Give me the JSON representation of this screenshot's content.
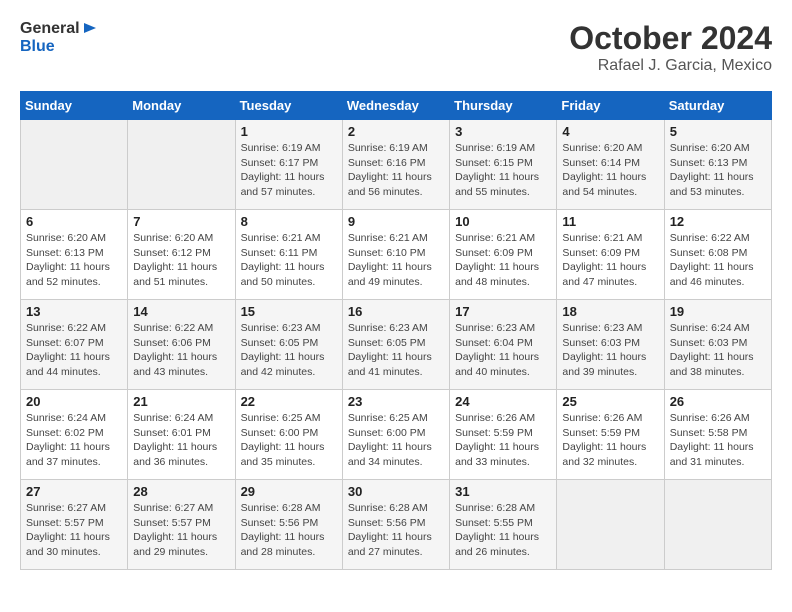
{
  "header": {
    "logo_line1": "General",
    "logo_line2": "Blue",
    "title": "October 2024",
    "subtitle": "Rafael J. Garcia, Mexico"
  },
  "calendar": {
    "days_of_week": [
      "Sunday",
      "Monday",
      "Tuesday",
      "Wednesday",
      "Thursday",
      "Friday",
      "Saturday"
    ],
    "weeks": [
      [
        {
          "day": "",
          "info": ""
        },
        {
          "day": "",
          "info": ""
        },
        {
          "day": "1",
          "info": "Sunrise: 6:19 AM\nSunset: 6:17 PM\nDaylight: 11 hours and 57 minutes."
        },
        {
          "day": "2",
          "info": "Sunrise: 6:19 AM\nSunset: 6:16 PM\nDaylight: 11 hours and 56 minutes."
        },
        {
          "day": "3",
          "info": "Sunrise: 6:19 AM\nSunset: 6:15 PM\nDaylight: 11 hours and 55 minutes."
        },
        {
          "day": "4",
          "info": "Sunrise: 6:20 AM\nSunset: 6:14 PM\nDaylight: 11 hours and 54 minutes."
        },
        {
          "day": "5",
          "info": "Sunrise: 6:20 AM\nSunset: 6:13 PM\nDaylight: 11 hours and 53 minutes."
        }
      ],
      [
        {
          "day": "6",
          "info": "Sunrise: 6:20 AM\nSunset: 6:13 PM\nDaylight: 11 hours and 52 minutes."
        },
        {
          "day": "7",
          "info": "Sunrise: 6:20 AM\nSunset: 6:12 PM\nDaylight: 11 hours and 51 minutes."
        },
        {
          "day": "8",
          "info": "Sunrise: 6:21 AM\nSunset: 6:11 PM\nDaylight: 11 hours and 50 minutes."
        },
        {
          "day": "9",
          "info": "Sunrise: 6:21 AM\nSunset: 6:10 PM\nDaylight: 11 hours and 49 minutes."
        },
        {
          "day": "10",
          "info": "Sunrise: 6:21 AM\nSunset: 6:09 PM\nDaylight: 11 hours and 48 minutes."
        },
        {
          "day": "11",
          "info": "Sunrise: 6:21 AM\nSunset: 6:09 PM\nDaylight: 11 hours and 47 minutes."
        },
        {
          "day": "12",
          "info": "Sunrise: 6:22 AM\nSunset: 6:08 PM\nDaylight: 11 hours and 46 minutes."
        }
      ],
      [
        {
          "day": "13",
          "info": "Sunrise: 6:22 AM\nSunset: 6:07 PM\nDaylight: 11 hours and 44 minutes."
        },
        {
          "day": "14",
          "info": "Sunrise: 6:22 AM\nSunset: 6:06 PM\nDaylight: 11 hours and 43 minutes."
        },
        {
          "day": "15",
          "info": "Sunrise: 6:23 AM\nSunset: 6:05 PM\nDaylight: 11 hours and 42 minutes."
        },
        {
          "day": "16",
          "info": "Sunrise: 6:23 AM\nSunset: 6:05 PM\nDaylight: 11 hours and 41 minutes."
        },
        {
          "day": "17",
          "info": "Sunrise: 6:23 AM\nSunset: 6:04 PM\nDaylight: 11 hours and 40 minutes."
        },
        {
          "day": "18",
          "info": "Sunrise: 6:23 AM\nSunset: 6:03 PM\nDaylight: 11 hours and 39 minutes."
        },
        {
          "day": "19",
          "info": "Sunrise: 6:24 AM\nSunset: 6:03 PM\nDaylight: 11 hours and 38 minutes."
        }
      ],
      [
        {
          "day": "20",
          "info": "Sunrise: 6:24 AM\nSunset: 6:02 PM\nDaylight: 11 hours and 37 minutes."
        },
        {
          "day": "21",
          "info": "Sunrise: 6:24 AM\nSunset: 6:01 PM\nDaylight: 11 hours and 36 minutes."
        },
        {
          "day": "22",
          "info": "Sunrise: 6:25 AM\nSunset: 6:00 PM\nDaylight: 11 hours and 35 minutes."
        },
        {
          "day": "23",
          "info": "Sunrise: 6:25 AM\nSunset: 6:00 PM\nDaylight: 11 hours and 34 minutes."
        },
        {
          "day": "24",
          "info": "Sunrise: 6:26 AM\nSunset: 5:59 PM\nDaylight: 11 hours and 33 minutes."
        },
        {
          "day": "25",
          "info": "Sunrise: 6:26 AM\nSunset: 5:59 PM\nDaylight: 11 hours and 32 minutes."
        },
        {
          "day": "26",
          "info": "Sunrise: 6:26 AM\nSunset: 5:58 PM\nDaylight: 11 hours and 31 minutes."
        }
      ],
      [
        {
          "day": "27",
          "info": "Sunrise: 6:27 AM\nSunset: 5:57 PM\nDaylight: 11 hours and 30 minutes."
        },
        {
          "day": "28",
          "info": "Sunrise: 6:27 AM\nSunset: 5:57 PM\nDaylight: 11 hours and 29 minutes."
        },
        {
          "day": "29",
          "info": "Sunrise: 6:28 AM\nSunset: 5:56 PM\nDaylight: 11 hours and 28 minutes."
        },
        {
          "day": "30",
          "info": "Sunrise: 6:28 AM\nSunset: 5:56 PM\nDaylight: 11 hours and 27 minutes."
        },
        {
          "day": "31",
          "info": "Sunrise: 6:28 AM\nSunset: 5:55 PM\nDaylight: 11 hours and 26 minutes."
        },
        {
          "day": "",
          "info": ""
        },
        {
          "day": "",
          "info": ""
        }
      ]
    ]
  }
}
